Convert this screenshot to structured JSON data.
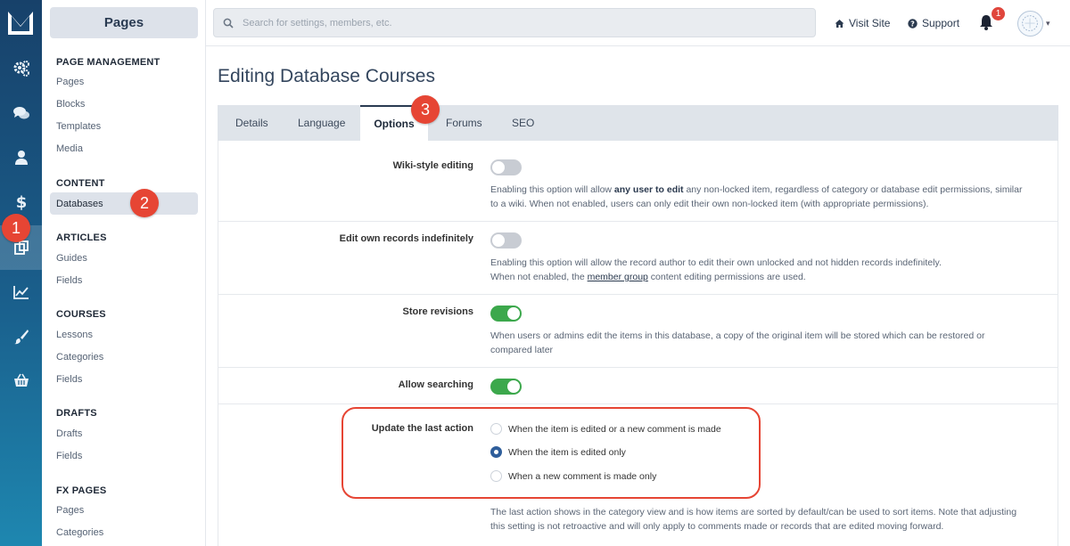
{
  "sidebar": {
    "title": "Pages",
    "sections": [
      {
        "heading": "PAGE MANAGEMENT",
        "items": [
          "Pages",
          "Blocks",
          "Templates",
          "Media"
        ]
      },
      {
        "heading": "CONTENT",
        "items": [
          "Databases"
        ]
      },
      {
        "heading": "ARTICLES",
        "items": [
          "Guides",
          "Fields"
        ]
      },
      {
        "heading": "COURSES",
        "items": [
          "Lessons",
          "Categories",
          "Fields"
        ]
      },
      {
        "heading": "DRAFTS",
        "items": [
          "Drafts",
          "Fields"
        ]
      },
      {
        "heading": "FX PAGES",
        "items": [
          "Pages",
          "Categories"
        ]
      }
    ]
  },
  "rail": {
    "icons": [
      "logo-icon",
      "gears-icon",
      "comments-icon",
      "user-icon",
      "dollar-icon",
      "pages-icon",
      "chart-icon",
      "brush-icon",
      "basket-icon"
    ]
  },
  "topbar": {
    "search_placeholder": "Search for settings, members, etc.",
    "visit_site": "Visit Site",
    "support": "Support",
    "notification_count": "1"
  },
  "page": {
    "title": "Editing Database Courses",
    "tabs": [
      "Details",
      "Language",
      "Options",
      "Forums",
      "SEO"
    ],
    "active_tab": "Options"
  },
  "settings": {
    "wiki": {
      "label": "Wiki-style editing",
      "enabled": false,
      "desc_1": "Enabling this option will allow ",
      "desc_bold": "any user to edit",
      "desc_2": " any non-locked item, regardless of category or database edit permissions, similar",
      "desc_3": "to a wiki. When not enabled, users can only edit their own non-locked item (with appropriate permissions)."
    },
    "edit_own": {
      "label": "Edit own records indefinitely",
      "enabled": false,
      "desc_1": "Enabling this option will allow the record author to edit their own unlocked and not hidden records indefinitely.",
      "desc_2": "When not enabled, the ",
      "desc_link": "member group",
      "desc_3": " content editing permissions are used."
    },
    "revisions": {
      "label": "Store revisions",
      "enabled": true,
      "desc_1": "When users or admins edit the items in this database, a copy of the original item will be stored which can be restored or",
      "desc_2": "compared later"
    },
    "searching": {
      "label": "Allow searching",
      "enabled": true
    },
    "last_action": {
      "label": "Update the last action",
      "options": [
        "When the item is edited or a new comment is made",
        "When the item is edited only",
        "When a new comment is made only"
      ],
      "selected": "When the item is edited only",
      "desc_1": "The last action shows in the category view and is how items are sorted by default/can be used to sort items. Note that adjusting",
      "desc_2": "this setting is not retroactive and will only apply to comments made or records that are edited moving forward."
    }
  },
  "callouts": [
    "1",
    "2",
    "3"
  ],
  "colors": {
    "accent": "#e64534",
    "toggle_on": "#3ca84c",
    "rail": "#1a5f8c"
  }
}
